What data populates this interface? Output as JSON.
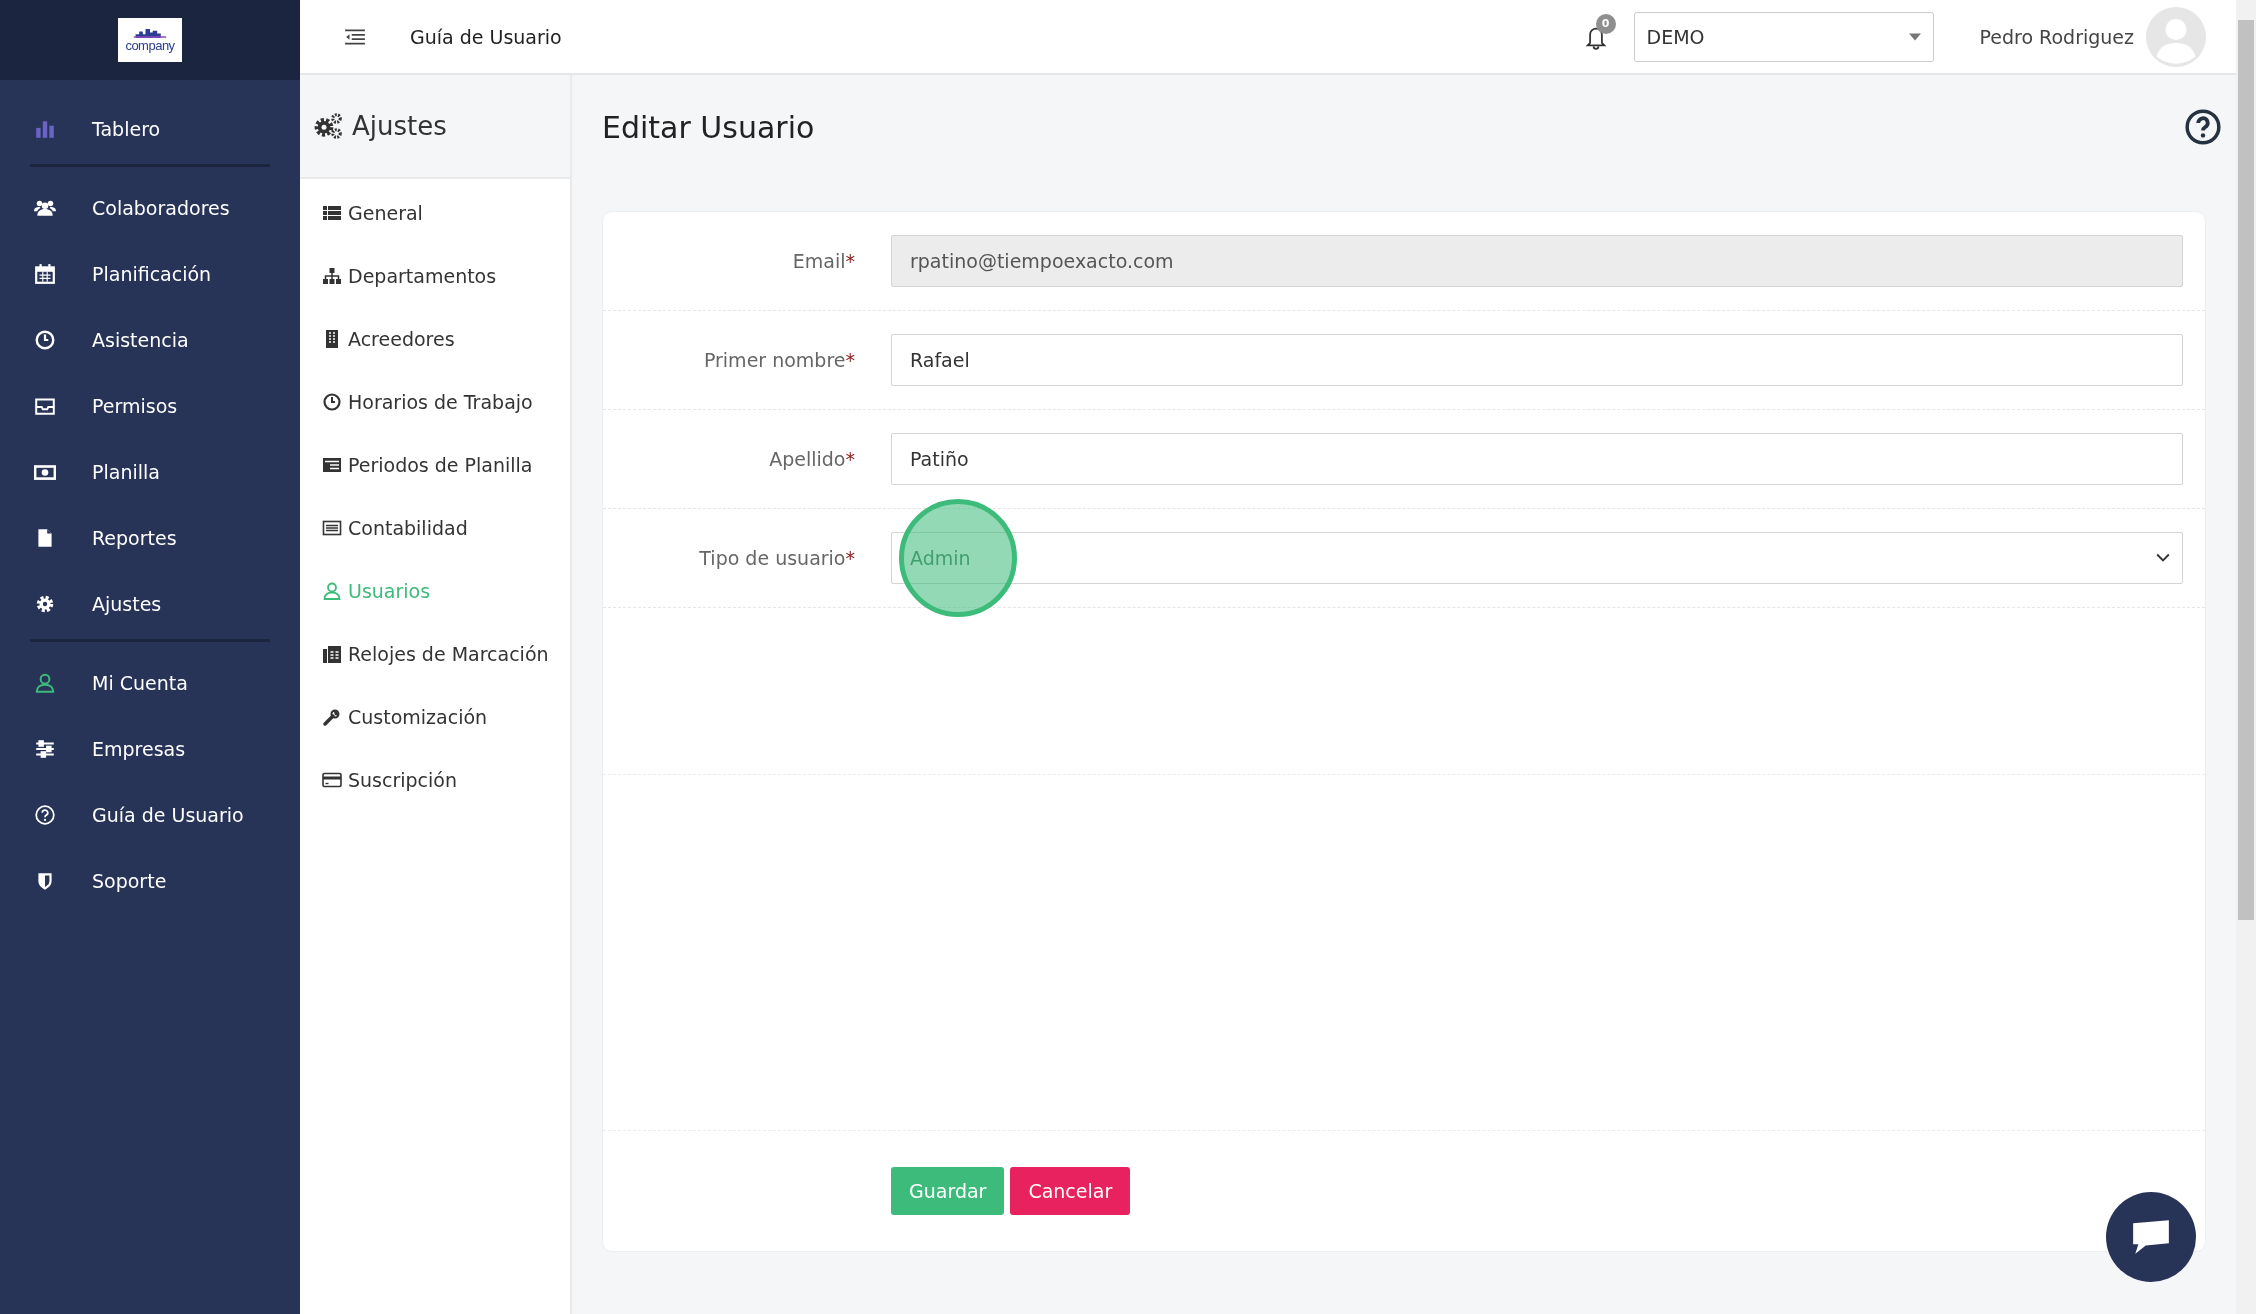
{
  "sidebar": {
    "logo": "company",
    "groups": [
      {
        "items": [
          {
            "label": "Tablero"
          }
        ]
      },
      {
        "items": [
          {
            "label": "Colaboradores"
          },
          {
            "label": "Planificación"
          },
          {
            "label": "Asistencia"
          },
          {
            "label": "Permisos"
          },
          {
            "label": "Planilla"
          },
          {
            "label": "Reportes"
          },
          {
            "label": "Ajustes"
          }
        ]
      },
      {
        "items": [
          {
            "label": "Mi Cuenta"
          },
          {
            "label": "Empresas"
          },
          {
            "label": "Guía de Usuario"
          },
          {
            "label": "Soporte"
          }
        ]
      }
    ]
  },
  "topbar": {
    "title": "Guía de Usuario",
    "notifications": "0",
    "company": "DEMO",
    "user": "Pedro Rodriguez"
  },
  "settings_menu": {
    "title": "Ajustes",
    "items": [
      {
        "label": "General",
        "selected": false
      },
      {
        "label": "Departamentos",
        "selected": false
      },
      {
        "label": "Acreedores",
        "selected": false
      },
      {
        "label": "Horarios de Trabajo",
        "selected": false
      },
      {
        "label": "Periodos de Planilla",
        "selected": false
      },
      {
        "label": "Contabilidad",
        "selected": false
      },
      {
        "label": "Usuarios",
        "selected": true
      },
      {
        "label": "Relojes de Marcación",
        "selected": false
      },
      {
        "label": "Customización",
        "selected": false
      },
      {
        "label": "Suscripción",
        "selected": false
      }
    ]
  },
  "page": {
    "title": "Editar Usuario"
  },
  "form": {
    "fields": [
      {
        "kind": "text",
        "label": "Email",
        "required_mark": "*",
        "value": "rpatino@tiempoexacto.com",
        "disabled": true
      },
      {
        "kind": "text",
        "label": "Primer nombre",
        "required_mark": "*",
        "value": "Rafael",
        "disabled": false
      },
      {
        "kind": "text",
        "label": "Apellido",
        "required_mark": "*",
        "value": "Patiño",
        "disabled": false
      },
      {
        "kind": "select",
        "label": "Tipo de usuario",
        "required_mark": "*",
        "value": "Admin",
        "disabled": false,
        "highlighted": true
      }
    ],
    "buttons": [
      {
        "kind": "primary",
        "label": "Guardar"
      },
      {
        "kind": "danger",
        "label": "Cancelar"
      }
    ]
  }
}
